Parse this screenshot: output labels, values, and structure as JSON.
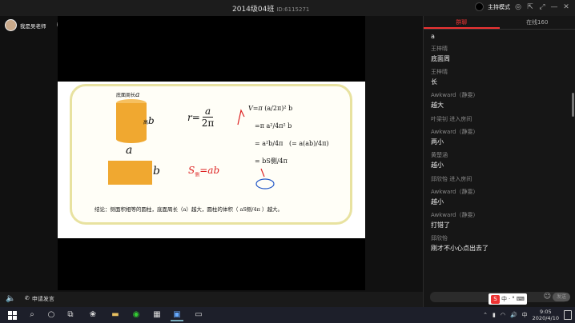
{
  "window": {
    "title": "2014级04班",
    "id_label": "ID:6115271",
    "host_mode_label": "主持模式"
  },
  "stage": {
    "teacher_name": "我是吴老师",
    "rank_label": "排麦",
    "apply_mic_label": "申请发言"
  },
  "slide": {
    "label_base_perimeter": "底面周长",
    "var_a": "a",
    "var_b": "b",
    "label_height": "高",
    "formula_r_lhs": "r=",
    "formula_r_num": "a",
    "formula_r_den": "2π",
    "s_side": "S",
    "s_side_sub": "侧",
    "s_side_eq": "=ab",
    "v_line1": "V=π",
    "v_line2": "=π",
    "v_line3": "=",
    "v_line4": "=",
    "conclusion": "结论：侧面积相等的圆柱，底面周长（a）越大，圆柱的体积（",
    "conclusion_tail": "）越大。"
  },
  "panel": {
    "tabs": [
      {
        "label": "群聊",
        "active": true
      },
      {
        "label": "在线160",
        "active": false
      }
    ],
    "first_text": "a",
    "messages": [
      {
        "type": "chat",
        "name": "王梓晴",
        "text": "底面周"
      },
      {
        "type": "chat",
        "name": "王梓晴",
        "text": "长"
      },
      {
        "type": "chat",
        "name": "Awkward（静雯）",
        "text": "越大"
      },
      {
        "type": "system",
        "text": "叶梁钊 进入房间"
      },
      {
        "type": "chat",
        "name": "Awkward（静雯）",
        "text": "两小"
      },
      {
        "type": "chat",
        "name": "黄楚涵",
        "text": "越小"
      },
      {
        "type": "system",
        "text": "邱欣怡 进入房间"
      },
      {
        "type": "chat",
        "name": "Awkward（静雯）",
        "text": "越小"
      },
      {
        "type": "chat",
        "name": "Awkward（静雯）",
        "text": "打错了"
      },
      {
        "type": "chat",
        "name": "邱欣怡",
        "text": "刚才不小心点出去了"
      }
    ],
    "send_label": "发送"
  },
  "ime": {
    "items": [
      "中",
      "·",
      "°",
      "⌨"
    ]
  },
  "taskbar": {
    "time": "9:05",
    "date": "2020/4/10"
  },
  "colors": {
    "accent_red": "#e33",
    "cylinder": "#f0a830",
    "board_border": "#e8e2a0"
  }
}
